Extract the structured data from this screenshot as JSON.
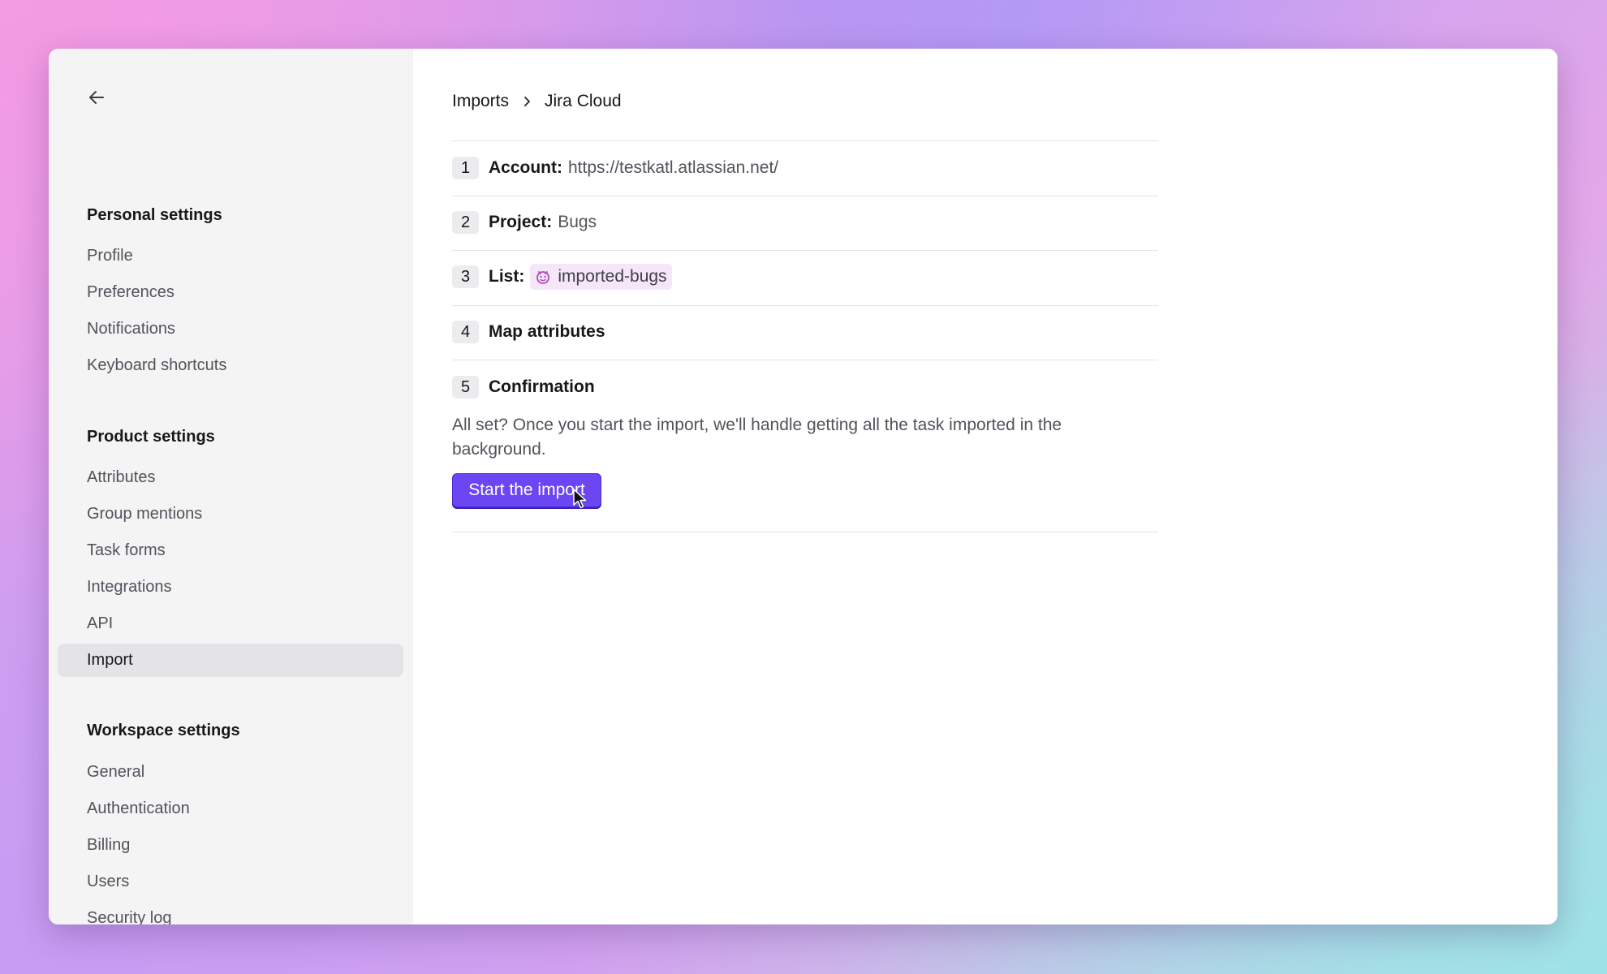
{
  "sidebar": {
    "back_icon": "arrow-left-icon",
    "sections": [
      {
        "title": "Personal settings",
        "items": [
          "Profile",
          "Preferences",
          "Notifications",
          "Keyboard shortcuts"
        ]
      },
      {
        "title": "Product settings",
        "items": [
          "Attributes",
          "Group mentions",
          "Task forms",
          "Integrations",
          "API",
          "Import"
        ]
      },
      {
        "title": "Workspace settings",
        "items": [
          "General",
          "Authentication",
          "Billing",
          "Users",
          "Security log"
        ]
      }
    ],
    "active_item": "Import"
  },
  "breadcrumb": {
    "root": "Imports",
    "current": "Jira Cloud",
    "separator_icon": "chevron-right-icon"
  },
  "steps": [
    {
      "number": "1",
      "label": "Account:",
      "value": "https://testkatl.atlassian.net/"
    },
    {
      "number": "2",
      "label": "Project:",
      "value": "Bugs"
    },
    {
      "number": "3",
      "label": "List:",
      "value": "imported-bugs",
      "icon": "bug-face-icon"
    },
    {
      "number": "4",
      "label": "Map attributes"
    },
    {
      "number": "5",
      "label": "Confirmation"
    }
  ],
  "confirmation": {
    "text": "All set? Once you start the import, we'll handle getting all the task imported in the background.",
    "button_label": "Start the import"
  },
  "colors": {
    "accent": "#6b46f2",
    "sidebar_bg": "#f4f4f5",
    "active_item_bg": "#e4e4e7",
    "list_chip_bg": "#f5e6fa"
  }
}
